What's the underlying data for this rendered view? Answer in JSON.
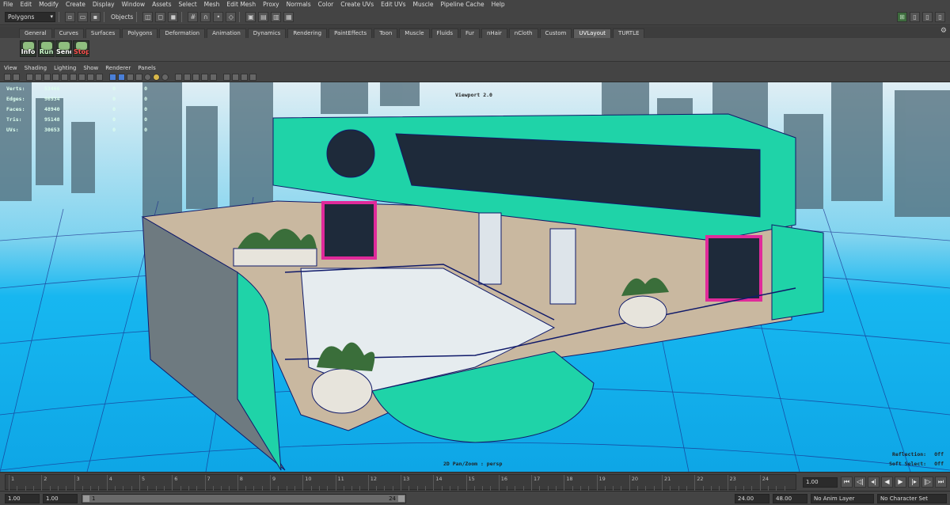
{
  "menubar": [
    "File",
    "Edit",
    "Modify",
    "Create",
    "Display",
    "Window",
    "Assets",
    "Select",
    "Mesh",
    "Edit Mesh",
    "Proxy",
    "Normals",
    "Color",
    "Create UVs",
    "Edit UVs",
    "Muscle",
    "Pipeline Cache",
    "Help"
  ],
  "statusline": {
    "mode": "Polygons",
    "objects_label": "Objects"
  },
  "shelf_tabs": [
    "General",
    "Curves",
    "Surfaces",
    "Polygons",
    "Deformation",
    "Animation",
    "Dynamics",
    "Rendering",
    "PaintEffects",
    "Toon",
    "Muscle",
    "Fluids",
    "Fur",
    "nHair",
    "nCloth",
    "Custom",
    "UVLayout",
    "TURTLE"
  ],
  "active_shelf_tab": "UVLayout",
  "shelf_buttons": [
    {
      "label": "Info",
      "kind": "info"
    },
    {
      "label": "Run",
      "kind": "run"
    },
    {
      "label": "Send",
      "kind": "send"
    },
    {
      "label": "Stop",
      "kind": "stop"
    }
  ],
  "panel_menu": [
    "View",
    "Shading",
    "Lighting",
    "Show",
    "Renderer",
    "Panels"
  ],
  "hud": {
    "title": "Viewport 2.0",
    "camera": "2D Pan/Zoom : persp",
    "header": "Verts:",
    "rows": [
      {
        "label": "Verts:",
        "v1": "53466",
        "v2": "0",
        "v3": "0"
      },
      {
        "label": "Edges:",
        "v1": "96934",
        "v2": "0",
        "v3": "0"
      },
      {
        "label": "Faces:",
        "v1": "48940",
        "v2": "0",
        "v3": "0"
      },
      {
        "label": "Tris:",
        "v1": "95148",
        "v2": "0",
        "v3": "0"
      },
      {
        "label": "UVs:",
        "v1": "30653",
        "v2": "0",
        "v3": "0"
      }
    ],
    "reflection_label": "Reflection:",
    "reflection_value": "Off",
    "soft_select_label": "Soft Select:",
    "soft_select_value": "Off"
  },
  "timeline": {
    "ticks": [
      "1",
      "2",
      "3",
      "4",
      "5",
      "6",
      "7",
      "8",
      "9",
      "10",
      "11",
      "12",
      "13",
      "14",
      "15",
      "16",
      "17",
      "18",
      "19",
      "20",
      "21",
      "22",
      "23",
      "24"
    ],
    "current_frame": "1.00"
  },
  "range": {
    "start": "1.00",
    "playback_start": "1.00",
    "bar_start": "1",
    "bar_end": "24",
    "playback_end": "24.00",
    "end": "48.00",
    "anim_layer": "No Anim Layer",
    "character_set": "No Character Set"
  },
  "colors": {
    "sky": "#10b5f0",
    "building": "#1fd3a8",
    "wire": "#101a6a",
    "accent": "#e02a9a",
    "deck": "#c9b8a0"
  }
}
